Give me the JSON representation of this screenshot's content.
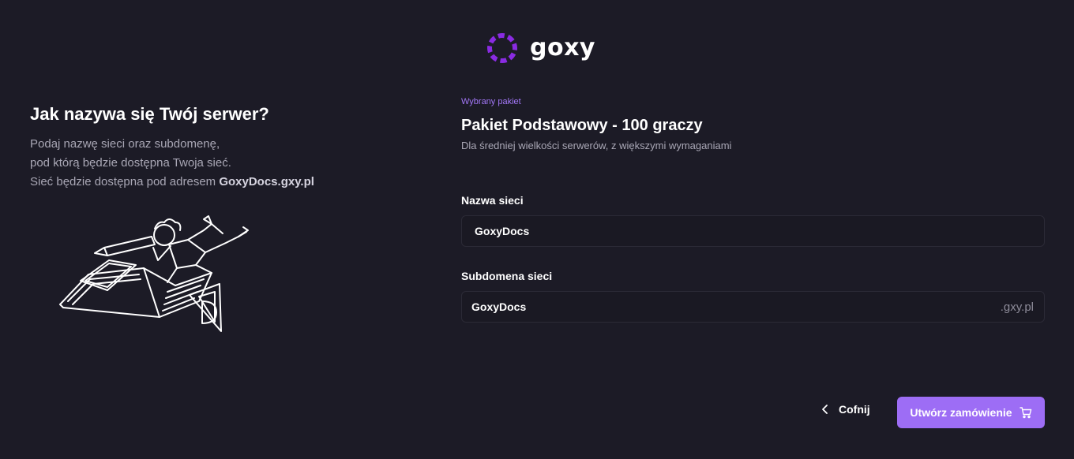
{
  "brand": {
    "name": "goxy",
    "accent": "#9d6df5",
    "logo_color": "#8a2be2"
  },
  "intro": {
    "title": "Jak nazywa się Twój serwer?",
    "line1": "Podaj nazwę sieci oraz subdomenę,",
    "line2": "pod którą będzie dostępna Twoja sieć.",
    "line3_prefix": "Sieć będzie dostępna pod adresem ",
    "line3_address": "GoxyDocs.gxy.pl"
  },
  "package": {
    "tag": "Wybrany pakiet",
    "name": "Pakiet Podstawowy - 100 graczy",
    "description": "Dla średniej wielkości serwerów, z większymi wymaganiami"
  },
  "form": {
    "network_name": {
      "label": "Nazwa sieci",
      "value": "GoxyDocs"
    },
    "subdomain": {
      "label": "Subdomena sieci",
      "value": "GoxyDocs",
      "suffix": ".gxy.pl"
    }
  },
  "actions": {
    "back_label": "Cofnij",
    "back_icon": "chevron-left-icon",
    "submit_label": "Utwórz zamówienie",
    "submit_icon": "cart-icon"
  }
}
